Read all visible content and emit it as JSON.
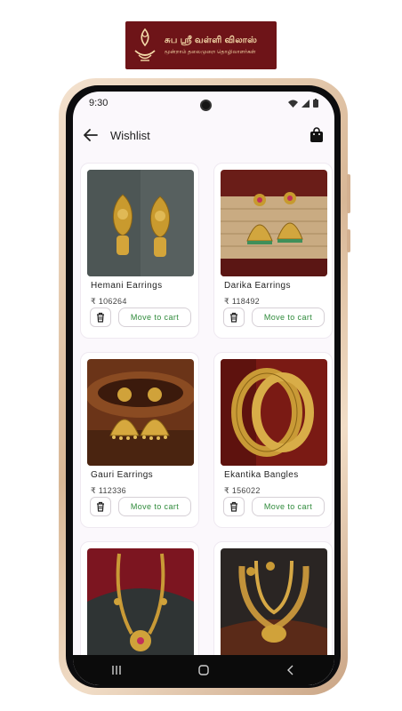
{
  "brand": {
    "main": "சுப ஸ்ரீ வள்ளி விலாஸ்",
    "sub": "மூன்றாம் தலைமுறை தொழிலாளர்கள்"
  },
  "status": {
    "time": "9:30"
  },
  "appbar": {
    "title": "Wishlist"
  },
  "colors": {
    "cart_green": "#2e8a3a",
    "brand_maroon": "#6e1418"
  },
  "items": [
    {
      "name": "Hemani Earrings",
      "price": "₹ 106264",
      "cart_label": "Move to cart"
    },
    {
      "name": "Darika Earrings",
      "price": "₹ 118492",
      "cart_label": "Move to cart"
    },
    {
      "name": "Gauri Earrings",
      "price": "₹ 112336",
      "cart_label": "Move to cart"
    },
    {
      "name": "Ekantika Bangles",
      "price": "₹ 156022",
      "cart_label": "Move to cart"
    },
    {
      "name": "",
      "price": "",
      "cart_label": ""
    },
    {
      "name": "",
      "price": "",
      "cart_label": ""
    }
  ]
}
